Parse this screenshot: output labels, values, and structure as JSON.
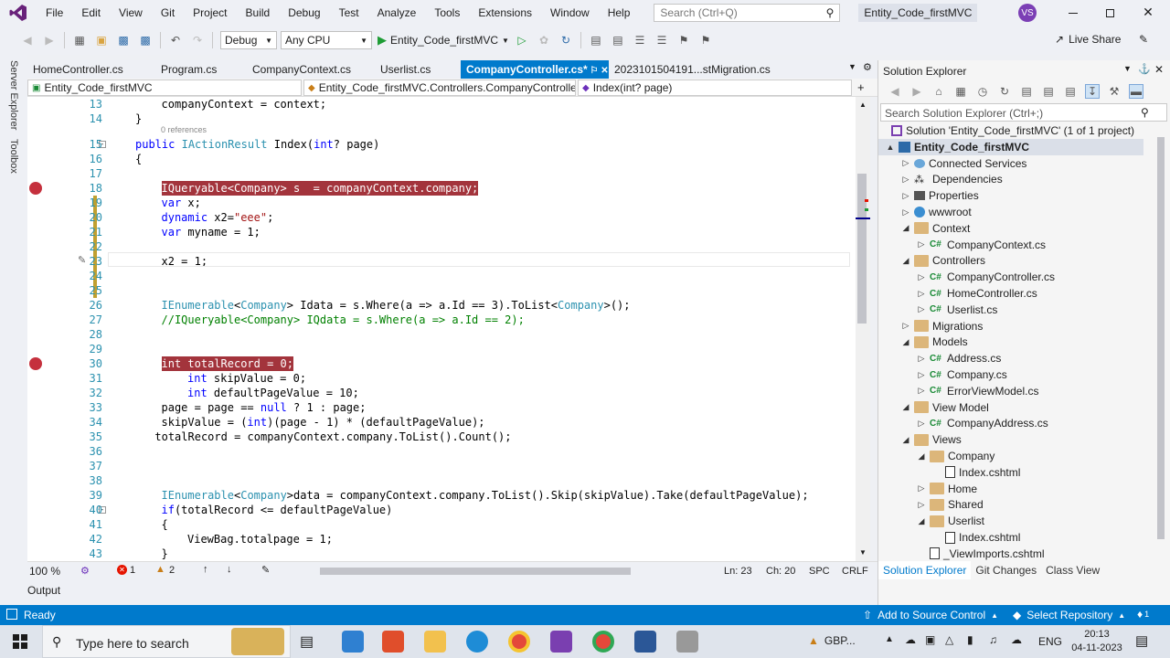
{
  "menubar": {
    "items": [
      "File",
      "Edit",
      "View",
      "Git",
      "Project",
      "Build",
      "Debug",
      "Test",
      "Analyze",
      "Tools",
      "Extensions",
      "Window",
      "Help"
    ],
    "search_placeholder": "Search (Ctrl+Q)",
    "solution_name": "Entity_Code_firstMVC",
    "user_initials": "VS"
  },
  "toolbar": {
    "config": "Debug",
    "platform": "Any CPU",
    "run_target": "Entity_Code_firstMVC",
    "live_share": "Live Share"
  },
  "side_tabs": [
    "Server Explorer",
    "Toolbox"
  ],
  "tabs": [
    {
      "label": "HomeController.cs",
      "active": false
    },
    {
      "label": "Program.cs",
      "active": false
    },
    {
      "label": "CompanyContext.cs",
      "active": false
    },
    {
      "label": "Userlist.cs",
      "active": false
    },
    {
      "label": "CompanyController.cs*",
      "active": true
    },
    {
      "label": "2023101504191...stMigration.cs",
      "active": false
    }
  ],
  "navbar": {
    "project": "Entity_Code_firstMVC",
    "class": "Entity_Code_firstMVC.Controllers.CompanyController",
    "member": "Index(int? page)"
  },
  "code": {
    "references_label": "0 references",
    "lines": [
      {
        "n": "13",
        "text": "companyContext = context;",
        "indent": 3,
        "bp": false,
        "hl": false
      },
      {
        "n": "14",
        "text": "}",
        "indent": 2,
        "bp": false,
        "hl": false
      },
      {
        "n": "15",
        "text": "public IActionResult Index(int? page)",
        "indent": 2,
        "bp": false,
        "hl": false
      },
      {
        "n": "16",
        "text": "{",
        "indent": 2,
        "bp": false,
        "hl": false
      },
      {
        "n": "17",
        "text": "",
        "indent": 3,
        "bp": false,
        "hl": false
      },
      {
        "n": "18",
        "text": "IQueryable<Company> s  = companyContext.company;",
        "indent": 3,
        "bp": true,
        "hl": true
      },
      {
        "n": "19",
        "text": "var x;",
        "indent": 3,
        "bp": false,
        "hl": false
      },
      {
        "n": "20",
        "text": "dynamic x2=\"eee\";",
        "indent": 3,
        "bp": false,
        "hl": false
      },
      {
        "n": "21",
        "text": "var myname = 1;",
        "indent": 3,
        "bp": false,
        "hl": false
      },
      {
        "n": "22",
        "text": "",
        "indent": 3,
        "bp": false,
        "hl": false
      },
      {
        "n": "23",
        "text": "x2 = 1;",
        "indent": 3,
        "bp": false,
        "hl": false
      },
      {
        "n": "24",
        "text": "",
        "indent": 3,
        "bp": false,
        "hl": false
      },
      {
        "n": "25",
        "text": "",
        "indent": 3,
        "bp": false,
        "hl": false
      },
      {
        "n": "26",
        "text": "IEnumerable<Company> Idata = s.Where(a => a.Id == 3).ToList<Company>();",
        "indent": 3,
        "bp": false,
        "hl": false
      },
      {
        "n": "27",
        "text": "//IQueryable<Company> IQdata = s.Where(a => a.Id == 2);",
        "indent": 3,
        "bp": false,
        "hl": false
      },
      {
        "n": "28",
        "text": "",
        "indent": 3,
        "bp": false,
        "hl": false
      },
      {
        "n": "29",
        "text": "",
        "indent": 3,
        "bp": false,
        "hl": false
      },
      {
        "n": "30",
        "text": "int totalRecord = 0;",
        "indent": 3,
        "bp": true,
        "hl": true
      },
      {
        "n": "31",
        "text": "int skipValue = 0;",
        "indent": 4,
        "bp": false,
        "hl": false
      },
      {
        "n": "32",
        "text": "int defaultPageValue = 10;",
        "indent": 4,
        "bp": false,
        "hl": false
      },
      {
        "n": "33",
        "text": "page = page == null ? 1 : page;",
        "indent": 3,
        "bp": false,
        "hl": false
      },
      {
        "n": "34",
        "text": "skipValue = (int)(page - 1) * (defaultPageValue);",
        "indent": 3,
        "bp": false,
        "hl": false
      },
      {
        "n": "35",
        "text": "totalRecord = companyContext.company.ToList().Count();",
        "indent": 2.75,
        "bp": false,
        "hl": false
      },
      {
        "n": "36",
        "text": "",
        "indent": 3,
        "bp": false,
        "hl": false
      },
      {
        "n": "37",
        "text": "",
        "indent": 3,
        "bp": false,
        "hl": false
      },
      {
        "n": "38",
        "text": "",
        "indent": 3,
        "bp": false,
        "hl": false
      },
      {
        "n": "39",
        "text": "IEnumerable<Company>data = companyContext.company.ToList().Skip(skipValue).Take(defaultPageValue);",
        "indent": 3,
        "bp": false,
        "hl": false
      },
      {
        "n": "40",
        "text": "if(totalRecord <= defaultPageValue)",
        "indent": 3,
        "bp": false,
        "hl": false
      },
      {
        "n": "41",
        "text": "{",
        "indent": 3,
        "bp": false,
        "hl": false
      },
      {
        "n": "42",
        "text": "ViewBag.totalpage = 1;",
        "indent": 4,
        "bp": false,
        "hl": false
      },
      {
        "n": "43",
        "text": "}",
        "indent": 3,
        "bp": false,
        "hl": false
      }
    ]
  },
  "editor_status": {
    "zoom": "100 %",
    "errors": "1",
    "warnings": "2",
    "ln": "Ln: 23",
    "ch": "Ch: 20",
    "spc": "SPC",
    "crlf": "CRLF"
  },
  "output_label": "Output",
  "solution_explorer": {
    "title": "Solution Explorer",
    "search_placeholder": "Search Solution Explorer (Ctrl+;)",
    "items": [
      {
        "label": "Solution 'Entity_Code_firstMVC' (1 of 1 project)",
        "level": 0,
        "twisty": "",
        "icon": "solution"
      },
      {
        "label": "Entity_Code_firstMVC",
        "level": 0,
        "twisty": "▲",
        "icon": "project",
        "selected": true
      },
      {
        "label": "Connected Services",
        "level": 1,
        "twisty": "▷",
        "icon": "service"
      },
      {
        "label": "Dependencies",
        "level": 1,
        "twisty": "▷",
        "icon": "deps"
      },
      {
        "label": "Properties",
        "level": 1,
        "twisty": "▷",
        "icon": "props"
      },
      {
        "label": "wwwroot",
        "level": 1,
        "twisty": "▷",
        "icon": "globe"
      },
      {
        "label": "Context",
        "level": 1,
        "twisty": "◢",
        "icon": "folder-open"
      },
      {
        "label": "CompanyContext.cs",
        "level": 2,
        "twisty": "▷",
        "icon": "cs"
      },
      {
        "label": "Controllers",
        "level": 1,
        "twisty": "◢",
        "icon": "folder-open"
      },
      {
        "label": "CompanyController.cs",
        "level": 2,
        "twisty": "▷",
        "icon": "cs"
      },
      {
        "label": "HomeController.cs",
        "level": 2,
        "twisty": "▷",
        "icon": "cs"
      },
      {
        "label": "Userlist.cs",
        "level": 2,
        "twisty": "▷",
        "icon": "cs"
      },
      {
        "label": "Migrations",
        "level": 1,
        "twisty": "▷",
        "icon": "folder"
      },
      {
        "label": "Models",
        "level": 1,
        "twisty": "◢",
        "icon": "folder-open"
      },
      {
        "label": "Address.cs",
        "level": 2,
        "twisty": "▷",
        "icon": "cs"
      },
      {
        "label": "Company.cs",
        "level": 2,
        "twisty": "▷",
        "icon": "cs"
      },
      {
        "label": "ErrorViewModel.cs",
        "level": 2,
        "twisty": "▷",
        "icon": "cs"
      },
      {
        "label": "View Model",
        "level": 1,
        "twisty": "◢",
        "icon": "folder-open"
      },
      {
        "label": "CompanyAddress.cs",
        "level": 2,
        "twisty": "▷",
        "icon": "cs"
      },
      {
        "label": "Views",
        "level": 1,
        "twisty": "◢",
        "icon": "folder-open"
      },
      {
        "label": "Company",
        "level": 2,
        "twisty": "◢",
        "icon": "folder-open"
      },
      {
        "label": "Index.cshtml",
        "level": 3,
        "twisty": "",
        "icon": "cshtml"
      },
      {
        "label": "Home",
        "level": 2,
        "twisty": "▷",
        "icon": "folder"
      },
      {
        "label": "Shared",
        "level": 2,
        "twisty": "▷",
        "icon": "folder"
      },
      {
        "label": "Userlist",
        "level": 2,
        "twisty": "◢",
        "icon": "folder-open"
      },
      {
        "label": "Index.cshtml",
        "level": 3,
        "twisty": "",
        "icon": "cshtml"
      },
      {
        "label": "_ViewImports.cshtml",
        "level": 2,
        "twisty": "",
        "icon": "cshtml"
      }
    ],
    "bottom_tabs": [
      "Solution Explorer",
      "Git Changes",
      "Class View"
    ]
  },
  "statusbar": {
    "ready": "Ready",
    "source_control": "Add to Source Control",
    "repository": "Select Repository",
    "notifications": "1"
  },
  "taskbar": {
    "search_placeholder": "Type here to search",
    "stock": "GBP...",
    "lang": "ENG",
    "time": "20:13",
    "date": "04-11-2023"
  },
  "colors": {
    "accent": "#007acc",
    "breakpoint": "#c5303d",
    "breakpoint_line": "#a3343c",
    "keyword": "#0000ff",
    "type": "#2b91af",
    "comment": "#008000",
    "string": "#a31515",
    "modified_bar": "#c0a030"
  }
}
